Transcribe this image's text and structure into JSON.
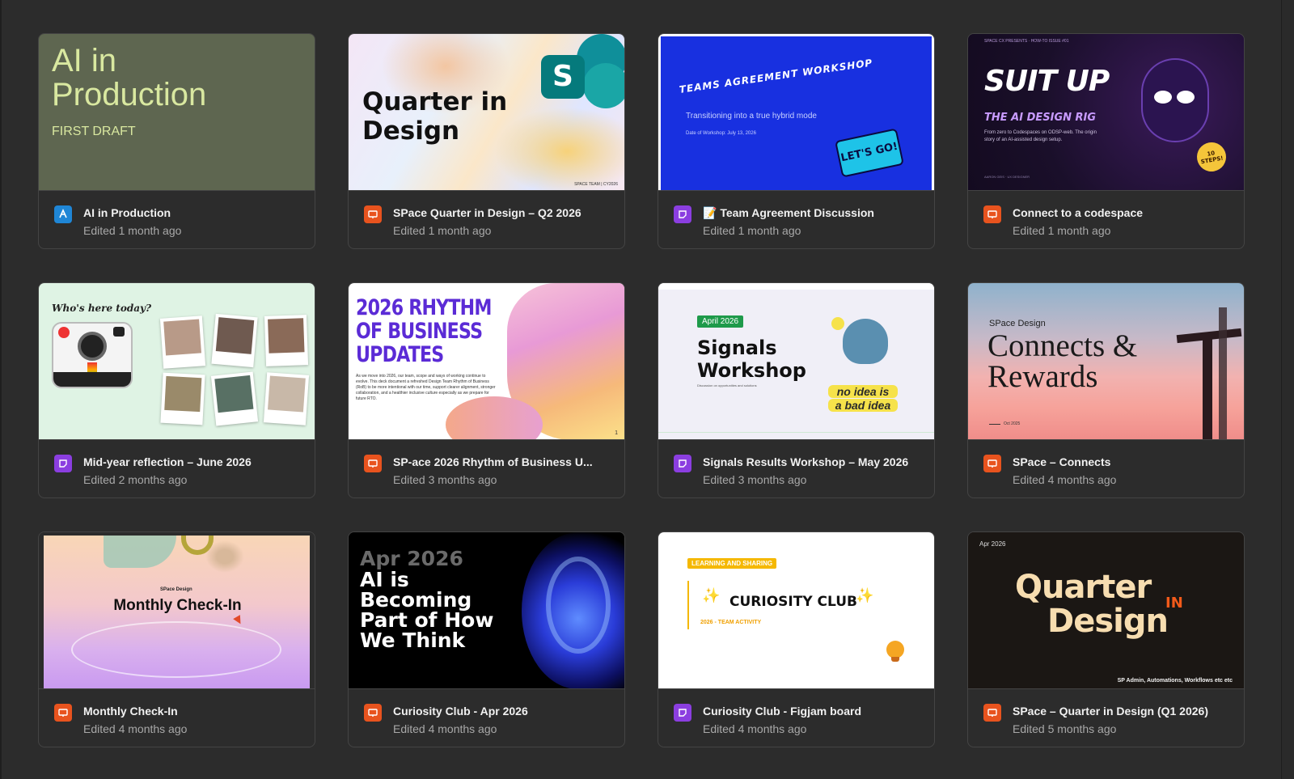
{
  "colors": {
    "slides_icon": "#e8531e",
    "figjam_icon": "#8b3ee0",
    "design_icon": "#1f86d6"
  },
  "cards": [
    {
      "title": "AI in Production",
      "edited": "Edited 1 month ago",
      "icon": "figma-design-icon",
      "thumb": {
        "line1": "AI in",
        "line2": "Production",
        "sub": "FIRST DRAFT"
      }
    },
    {
      "title": "SPace Quarter in Design – Q2 2026",
      "edited": "Edited 1 month ago",
      "icon": "slides-icon",
      "thumb": {
        "line1": "Quarter in",
        "line2": "Design",
        "logo_letter": "S",
        "footer": "SPACE TEAM | CY2026"
      }
    },
    {
      "title": "📝 Team Agreement Discussion",
      "edited": "Edited 1 month ago",
      "icon": "figjam-icon",
      "thumb": {
        "heading": "Teams Agreement Workshop",
        "sub": "Transitioning into a true hybrid mode",
        "date": "Date of Workshop: July 13, 2026",
        "sticker": "LET'S GO!"
      }
    },
    {
      "title": "Connect to a codespace",
      "edited": "Edited 1 month ago",
      "icon": "slides-icon",
      "thumb": {
        "kicker": "SPACE CX PRESENTS · HOW-TO ISSUE #01",
        "heading": "SUIT UP",
        "sub": "THE AI DESIGN RIG",
        "desc": "From zero to Codespaces on ODSP-web. The origin story of an AI-assisted design setup.",
        "badge": "10 STEPS!",
        "author": "AARON GEIS · UX DESIGNER"
      }
    },
    {
      "title": "Mid-year reflection – June 2026",
      "edited": "Edited 2 months ago",
      "icon": "figjam-icon",
      "thumb": {
        "heading": "Who's here today?"
      }
    },
    {
      "title": "SP-ace 2026 Rhythm of Business U...",
      "edited": "Edited 3 months ago",
      "icon": "slides-icon",
      "thumb": {
        "line1": "2026 RHYTHM",
        "line2": "OF BUSINESS",
        "line3": "UPDATES",
        "body": "As we move into 2026, our team, scope and ways of working continue to evolve. This deck document a refreshed Design Team Rhythm of Business (RoB) to be more intentional with our time, support clearer alignment, stronger collaboration, and a healthier inclusive culture especially as we prepare for future RTO.",
        "page": "1"
      }
    },
    {
      "title": "Signals Results Workshop – May 2026",
      "edited": "Edited 3 months ago",
      "icon": "figjam-icon",
      "thumb": {
        "tag": "April 2026",
        "line1": "Signals",
        "line2": "Workshop",
        "small": "Discussion on opportunities and solutions",
        "sticker1": "no idea is",
        "sticker2": "a bad idea"
      }
    },
    {
      "title": "SPace – Connects",
      "edited": "Edited 4 months ago",
      "icon": "slides-icon",
      "thumb": {
        "kicker": "SPace Design",
        "line1": "Connects &",
        "line2": "Rewards",
        "date": "Oct 2025"
      }
    },
    {
      "title": "Monthly Check-In",
      "edited": "Edited 4 months ago",
      "icon": "slides-icon",
      "thumb": {
        "kicker": "SPace Design",
        "heading": "Monthly Check-In"
      }
    },
    {
      "title": "Curiosity Club - Apr 2026",
      "edited": "Edited 4 months ago",
      "icon": "slides-icon",
      "thumb": {
        "line0": "Apr 2026",
        "line1": "AI is",
        "line2": "Becoming",
        "line3": "Part of How",
        "line4": "We Think"
      }
    },
    {
      "title": "Curiosity Club - Figjam board",
      "edited": "Edited 4 months ago",
      "icon": "figjam-icon",
      "thumb": {
        "tag": "LEARNING AND SHARING",
        "heading": "CURIOSITY CLUB",
        "sub": "2026 - TEAM ACTIVITY"
      }
    },
    {
      "title": "SPace – Quarter in Design (Q1 2026)",
      "edited": "Edited 5 months ago",
      "icon": "slides-icon",
      "thumb": {
        "date": "Apr 2026",
        "line1": "Quarter",
        "in": "IN",
        "line2": "Design",
        "footer": "SP Admin, Automations, Workflows etc etc"
      }
    }
  ]
}
